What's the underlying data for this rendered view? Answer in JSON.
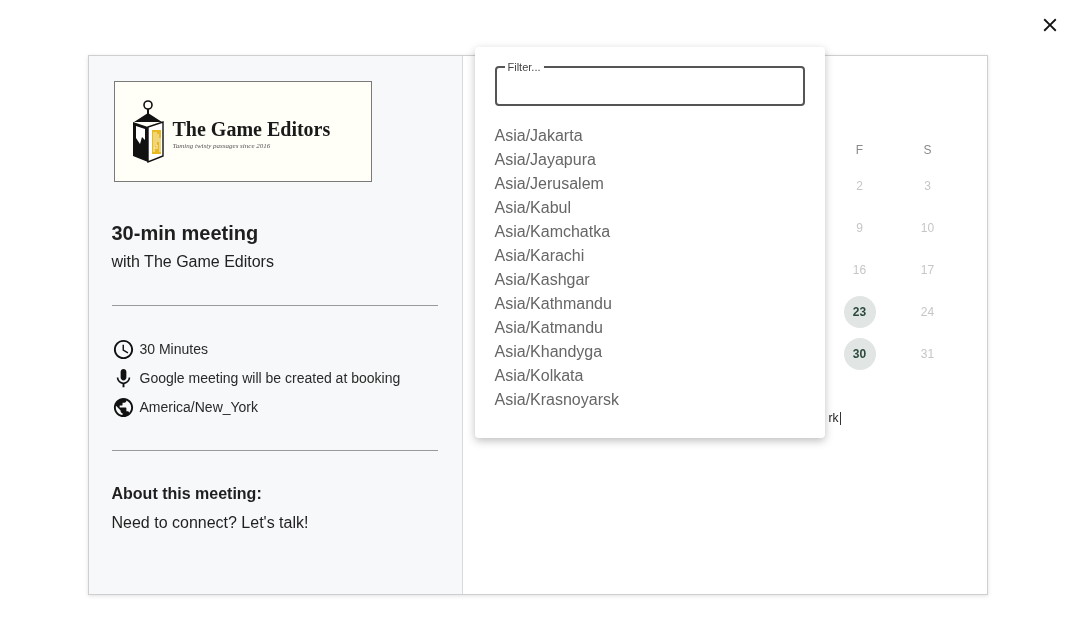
{
  "logo": {
    "title": "The Game Editors",
    "tagline": "Taming twisty passages since 2016"
  },
  "meeting": {
    "title": "30-min meeting",
    "host": "with The Game Editors"
  },
  "details": [
    {
      "kind": "duration",
      "text": "30 Minutes"
    },
    {
      "kind": "location",
      "text": "Google meeting will be created at booking"
    },
    {
      "kind": "timezone",
      "text": "America/New_York"
    }
  ],
  "about": {
    "heading": "About this meeting:",
    "text": "Need to connect? Let's talk!"
  },
  "calendar": {
    "columns": [
      {
        "header": "F",
        "days": [
          {
            "label": "2",
            "available": false
          },
          {
            "label": "9",
            "available": false
          },
          {
            "label": "16",
            "available": false
          },
          {
            "label": "23",
            "available": true
          },
          {
            "label": "30",
            "available": true
          }
        ]
      },
      {
        "header": "S",
        "days": [
          {
            "label": "3",
            "available": false
          },
          {
            "label": "10",
            "available": false
          },
          {
            "label": "17",
            "available": false
          },
          {
            "label": "24",
            "available": false
          },
          {
            "label": "31",
            "available": false
          }
        ]
      }
    ]
  },
  "timezone_field": {
    "value": "rk"
  },
  "timezone_menu": {
    "filter": {
      "label": "Filter..."
    },
    "options": [
      {
        "label": "Asia/Jakarta",
        "selected": false
      },
      {
        "label": "Asia/Jayapura",
        "selected": false
      },
      {
        "label": "Asia/Jerusalem",
        "selected": false
      },
      {
        "label": "Asia/Kabul",
        "selected": false
      },
      {
        "label": "Asia/Kamchatka",
        "selected": false
      },
      {
        "label": "Asia/Karachi",
        "selected": false
      },
      {
        "label": "Asia/Kashgar",
        "selected": false
      },
      {
        "label": "Asia/Kathmandu",
        "selected": false
      },
      {
        "label": "Asia/Katmandu",
        "selected": false
      },
      {
        "label": "Asia/Khandyga",
        "selected": false
      },
      {
        "label": "Asia/Kolkata",
        "selected": false
      },
      {
        "label": "Asia/Krasnoyarsk",
        "selected": false
      }
    ]
  }
}
